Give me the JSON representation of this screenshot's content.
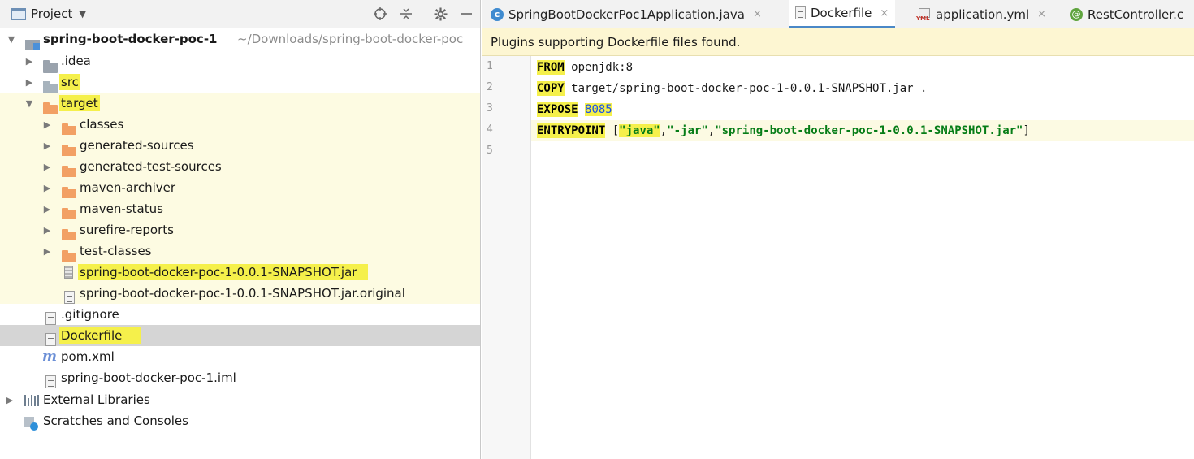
{
  "panel": {
    "title": "Project",
    "header_icons": [
      "crosshair-icon",
      "collapse-icon",
      "gear-icon",
      "minimize-icon"
    ]
  },
  "tree": {
    "root": {
      "label": "spring-boot-docker-poc-1",
      "path": "~/Downloads/spring-boot-docker-poc"
    },
    "idea": ".idea",
    "src": "src",
    "target": "target",
    "target_children": [
      "classes",
      "generated-sources",
      "generated-test-sources",
      "maven-archiver",
      "maven-status",
      "surefire-reports",
      "test-classes"
    ],
    "jar": "spring-boot-docker-poc-1-0.0.1-SNAPSHOT.jar",
    "jar_original": "spring-boot-docker-poc-1-0.0.1-SNAPSHOT.jar.original",
    "gitignore": ".gitignore",
    "dockerfile": "Dockerfile",
    "pom": "pom.xml",
    "iml": "spring-boot-docker-poc-1.iml",
    "external_libraries": "External Libraries",
    "scratches": "Scratches and Consoles"
  },
  "tabs": [
    {
      "label": "SpringBootDockerPoc1Application.java",
      "icon": "class-c-icon"
    },
    {
      "label": "Dockerfile",
      "icon": "dockerfile-icon",
      "active": true
    },
    {
      "label": "application.yml",
      "icon": "yml-icon"
    },
    {
      "label": "RestController.c",
      "icon": "annotation-icon"
    }
  ],
  "tab_close": "×",
  "notice": "Plugins supporting Dockerfile files found.",
  "editor": {
    "line_numbers": [
      "1",
      "2",
      "3",
      "4",
      "5"
    ],
    "lines": [
      {
        "kw": "FROM",
        "rest": " openjdk:8"
      },
      {
        "kw": "COPY",
        "rest": " target/spring-boot-docker-poc-1-0.0.1-SNAPSHOT.jar ."
      },
      {
        "kw": "EXPOSE",
        "num": "8085"
      },
      {
        "kw": "ENTRYPOINT",
        "open": " [",
        "s1": "\"java\"",
        "c1": ",",
        "s2": "\"-jar\"",
        "c2": ",",
        "s3": "\"spring-boot-docker-poc-1-0.0.1-SNAPSHOT.jar\"",
        "close": "]"
      }
    ]
  },
  "colors": {
    "highlight": "#f5f04b",
    "selection": "#d5d5d5",
    "accent": "#4a88c7"
  }
}
